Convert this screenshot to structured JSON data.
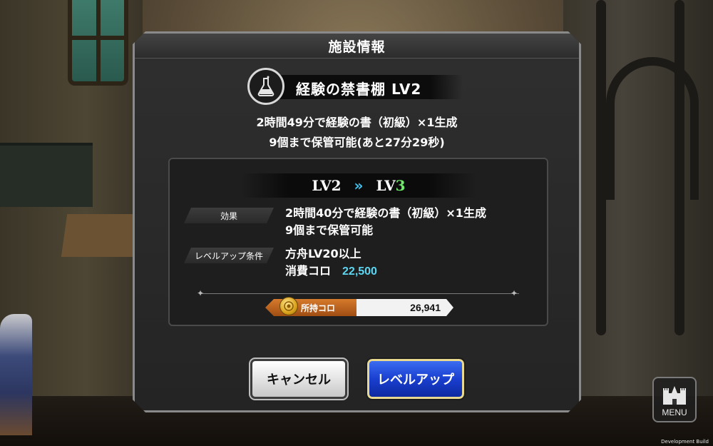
{
  "dialog": {
    "title": "施設情報",
    "facility_name": "経験の禁書棚 LV2",
    "facility_icon": "flask-icon",
    "desc_line1": "2時間49分で経験の書（初級）×1生成",
    "desc_line2": "9個まで保管可能(あと27分29秒)"
  },
  "upgrade": {
    "level_from": "LV2",
    "arrow": "»",
    "level_to_prefix": "LV",
    "level_to_num": "3",
    "effect_label": "効果",
    "effect_line1": "2時間40分で経験の書（初級）×1生成",
    "effect_line2": "9個まで保管可能",
    "condition_label": "レベルアップ条件",
    "condition_line1": "方舟LV20以上",
    "cost_label": "消費コロ",
    "cost_value": "22,500",
    "owned_label": "所持コロ",
    "owned_value": "26,941"
  },
  "buttons": {
    "cancel": "キャンセル",
    "level_up": "レベルアップ"
  },
  "menu": {
    "label": "MENU",
    "icon": "castle-icon"
  },
  "footer": {
    "dev_build": "Development Build"
  },
  "colors": {
    "lv_arrow": "#3fc4f2",
    "lv_new": "#6fe86b",
    "cost_value": "#5cd6f2",
    "level_up_button": "#1a3fd0",
    "coin_tag": "#c0641e"
  }
}
